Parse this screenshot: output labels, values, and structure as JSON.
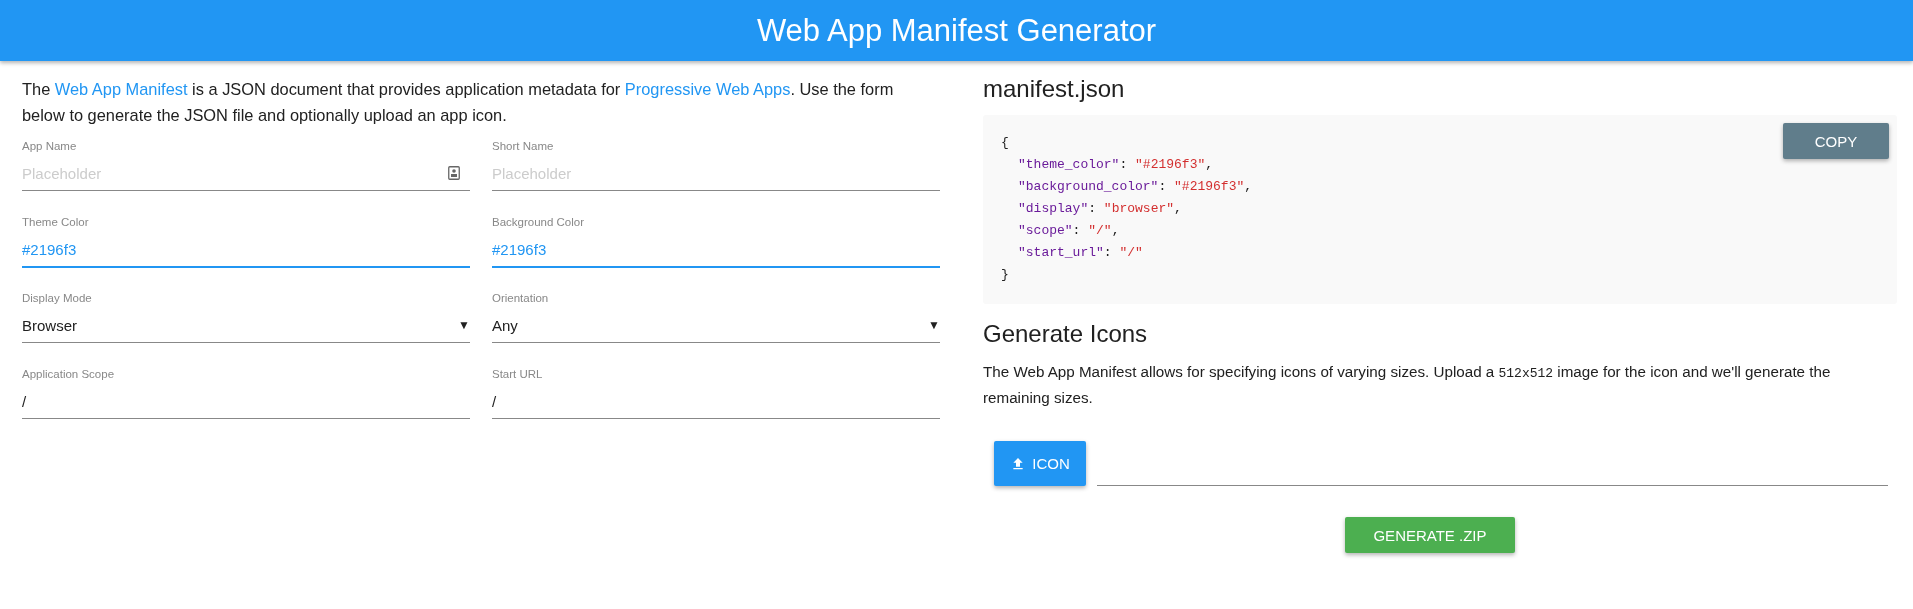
{
  "header": {
    "title": "Web App Manifest Generator"
  },
  "intro": [
    {
      "kind": "text",
      "text": "The "
    },
    {
      "kind": "link",
      "text": "Web App Manifest"
    },
    {
      "kind": "text",
      "text": " is a JSON document that provides application metadata for "
    },
    {
      "kind": "link",
      "text": "Progressive Web Apps"
    },
    {
      "kind": "text",
      "text": ". Use the form below to generate the JSON file and optionally upload an app icon."
    }
  ],
  "fields": [
    {
      "kind": "text",
      "label": "App Name",
      "placeholder": "Placeholder",
      "badge": true
    },
    {
      "kind": "text",
      "label": "Short Name",
      "placeholder": "Placeholder",
      "badge": false
    },
    {
      "kind": "color",
      "label": "Theme Color",
      "value": "#2196f3"
    },
    {
      "kind": "color",
      "label": "Background Color",
      "value": "#2196f3"
    },
    {
      "kind": "select",
      "label": "Display Mode",
      "value": "Browser",
      "caret": "▼"
    },
    {
      "kind": "select",
      "label": "Orientation",
      "value": "Any",
      "caret": "▼"
    },
    {
      "kind": "text",
      "label": "Application Scope",
      "value": "/"
    },
    {
      "kind": "text",
      "label": "Start URL",
      "value": "/"
    }
  ],
  "manifest": {
    "title": "manifest.json",
    "copy_button": "COPY",
    "lines": [
      {
        "kind": "brace",
        "text": "{"
      },
      {
        "kind": "entry",
        "key": "\"theme_color\"",
        "colon": ": ",
        "value": "\"#2196f3\"",
        "comma": ","
      },
      {
        "kind": "entry",
        "key": "\"background_color\"",
        "colon": ": ",
        "value": "\"#2196f3\"",
        "comma": ","
      },
      {
        "kind": "entry",
        "key": "\"display\"",
        "colon": ": ",
        "value": "\"browser\"",
        "comma": ","
      },
      {
        "kind": "entry",
        "key": "\"scope\"",
        "colon": ": ",
        "value": "\"/\"",
        "comma": ","
      },
      {
        "kind": "entry",
        "key": "\"start_url\"",
        "colon": ": ",
        "value": "\"/\""
      },
      {
        "kind": "brace",
        "text": "}"
      }
    ]
  },
  "icons": {
    "title": "Generate Icons",
    "description": [
      {
        "kind": "text",
        "text": "The Web App Manifest allows for specifying icons of varying sizes. Upload a "
      },
      {
        "kind": "code",
        "text": "512x512"
      },
      {
        "kind": "text",
        "text": " image for the icon and we'll generate the remaining sizes."
      }
    ],
    "upload_button": "ICON",
    "generate_button": "GENERATE .ZIP"
  }
}
